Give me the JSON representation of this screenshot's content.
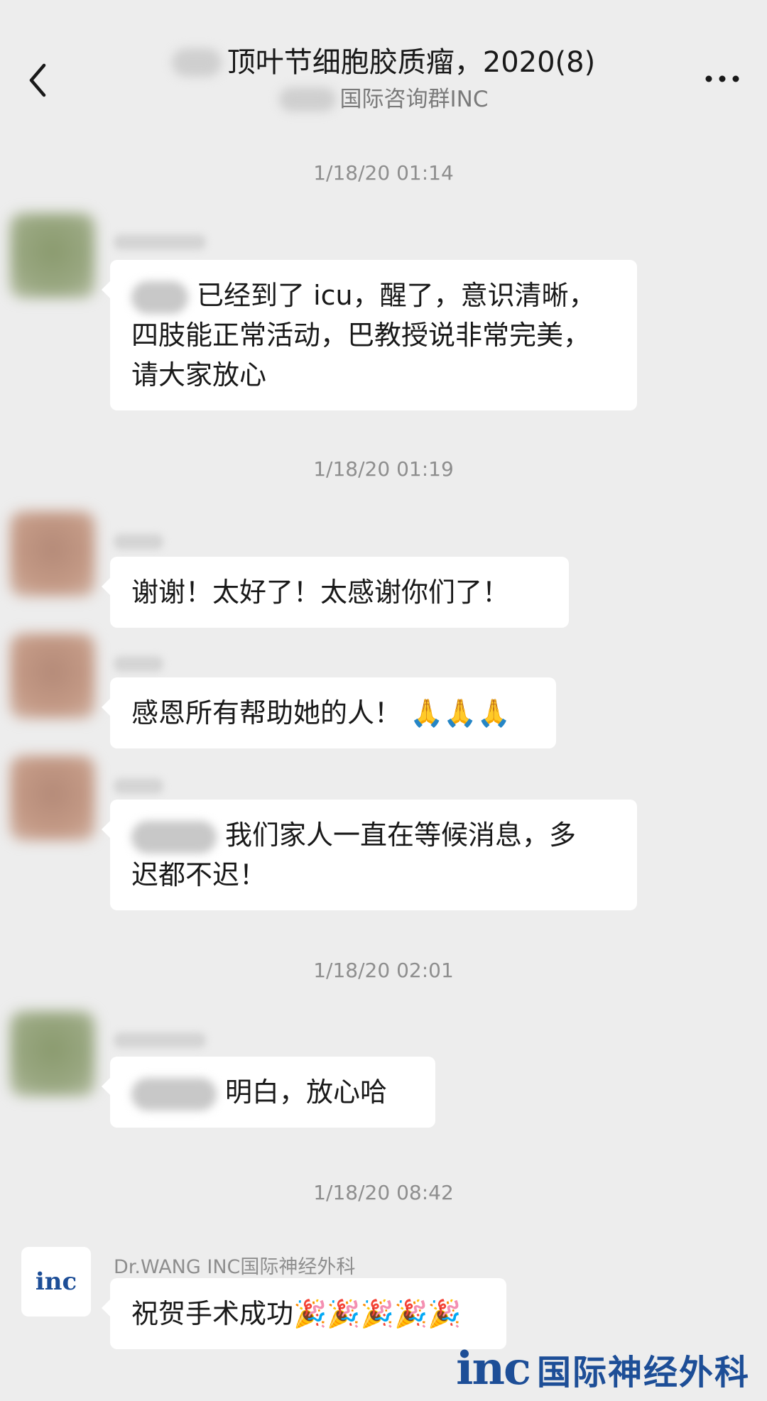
{
  "header": {
    "title": "顶叶节细胞胶质瘤，2020(8)",
    "subtitle": "国际咨询群INC",
    "back_icon": "chevron-left-icon",
    "more_icon": "more-dots-icon"
  },
  "timestamps": {
    "t1": "1/18/20 01:14",
    "t2": "1/18/20 01:19",
    "t3": "1/18/20 02:01",
    "t4": "1/18/20 08:42"
  },
  "messages": [
    {
      "text_line1": "已经到了 icu，醒了，意识清晰，",
      "text_line2": "四肢能正常活动，巴教授说非常完美，",
      "text_line3": "请大家放心"
    },
    {
      "text": "谢谢！太好了！太感谢你们了！"
    },
    {
      "text": "感恩所有帮助她的人！",
      "emoji": "🙏🙏🙏"
    },
    {
      "text_line1": "我们家人一直在等候消息，多",
      "text_line2": "迟都不迟！"
    },
    {
      "text": "明白，放心哈"
    },
    {
      "sender": "Dr.WANG  INC国际神经外科",
      "text": "祝贺手术成功",
      "emoji": "🎉🎉🎉🎉🎉"
    }
  ],
  "inc_avatar_text": "inc",
  "watermark": {
    "logo_text": "inc",
    "text": "国际神经外科",
    "color": "#1d4e97"
  }
}
